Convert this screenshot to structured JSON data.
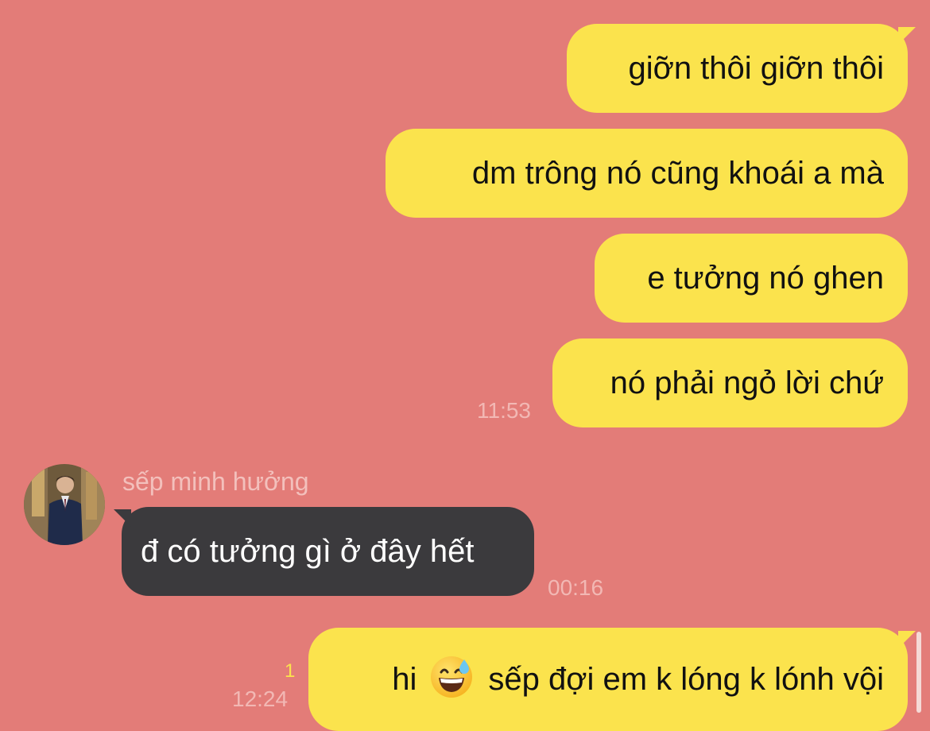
{
  "messages": [
    {
      "id": "m1",
      "direction": "outgoing",
      "text": "giỡn thôi giỡn thôi"
    },
    {
      "id": "m2",
      "direction": "outgoing",
      "text": "dm trông nó cũng khoái a mà"
    },
    {
      "id": "m3",
      "direction": "outgoing",
      "text": "e tưởng nó ghen"
    },
    {
      "id": "m4",
      "direction": "outgoing",
      "text": "nó phải ngỏ lời chứ",
      "time": "11:53"
    },
    {
      "id": "m5",
      "direction": "incoming",
      "sender": "sếp minh hưởng",
      "text": "đ có tưởng gì ở đây hết",
      "time": "00:16"
    },
    {
      "id": "m6",
      "direction": "outgoing",
      "text_before_emoji": "hi",
      "emoji": "grinning-face-with-sweat-icon",
      "text_after_emoji": "sếp đợi em k lóng k lónh vội",
      "time": "12:24",
      "unread_count": "1"
    }
  ],
  "colors": {
    "background": "#e37c78",
    "outgoing_bubble": "#fbe34d",
    "incoming_bubble": "#3b3a3d",
    "timestamp": "#f2b8b4"
  }
}
